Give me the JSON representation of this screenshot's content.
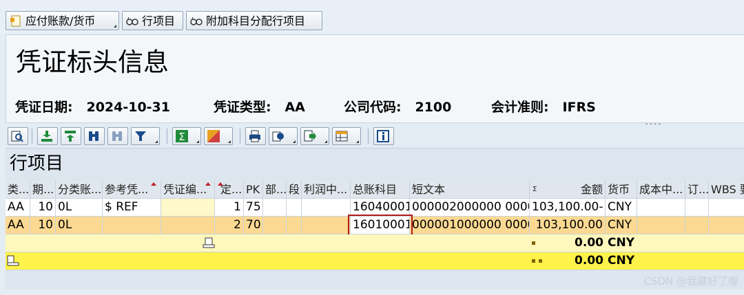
{
  "toolbar": {
    "buttons": [
      {
        "label": "应付账款/货币",
        "icon": "document-icon"
      },
      {
        "label": "行项目",
        "icon": "glasses-icon"
      },
      {
        "label": "附加科目分配行项目",
        "icon": "glasses-icon"
      }
    ]
  },
  "header": {
    "title": "凭证标头信息",
    "fields": [
      {
        "label": "凭证日期:",
        "value": "2024-10-31"
      },
      {
        "label": "凭证类型:",
        "value": "AA"
      },
      {
        "label": "公司代码:",
        "value": "2100"
      },
      {
        "label": "会计准则:",
        "value": "IFRS"
      }
    ]
  },
  "alv_toolbar": {
    "icons": [
      "details-icon",
      "sort-ascending-icon",
      "sort-descending-icon",
      "find-icon",
      "find-next-icon",
      "filter-icon",
      "sum-icon",
      "subtotal-icon",
      "print-icon",
      "views-icon",
      "export-icon",
      "layout-icon",
      "info-icon"
    ]
  },
  "grid": {
    "title": "行项目",
    "columns": [
      "类...",
      "期...",
      "分类账...",
      "参考凭...",
      "凭证编...",
      "定...",
      "PK",
      "部...",
      "段",
      "利润中...",
      "总账科目",
      "短文本",
      "金额",
      "货币",
      "成本中...",
      "订...",
      "WBS 要"
    ],
    "rows": [
      {
        "c0": "AA",
        "c1": "10",
        "c2": "0L",
        "c3": "$ REF",
        "c4": "",
        "c5": "1",
        "c6": "75",
        "c7": "",
        "c8": "",
        "c9": "",
        "c10": "16040001",
        "c11": "000002000000 0000",
        "c12": "103,100.00-",
        "c13": "CNY"
      },
      {
        "c0": "AA",
        "c1": "10",
        "c2": "0L",
        "c3": "",
        "c4": "",
        "c5": "2",
        "c6": "70",
        "c7": "",
        "c8": "",
        "c9": "",
        "c10": "16010001",
        "c11": "000001000000 0000",
        "c12": "103,100.00",
        "c13": "CNY"
      }
    ],
    "subtotal": {
      "amount": "0.00",
      "currency": "CNY"
    },
    "total": {
      "amount": "0.00",
      "currency": "CNY"
    }
  },
  "watermark": "CSDN @我藏好了喔",
  "colors": {
    "selected_row": "#fbd992",
    "subtotal_row": "#fff8bc",
    "total_row": "#fff24a",
    "sort_marker": "#c0202a"
  }
}
